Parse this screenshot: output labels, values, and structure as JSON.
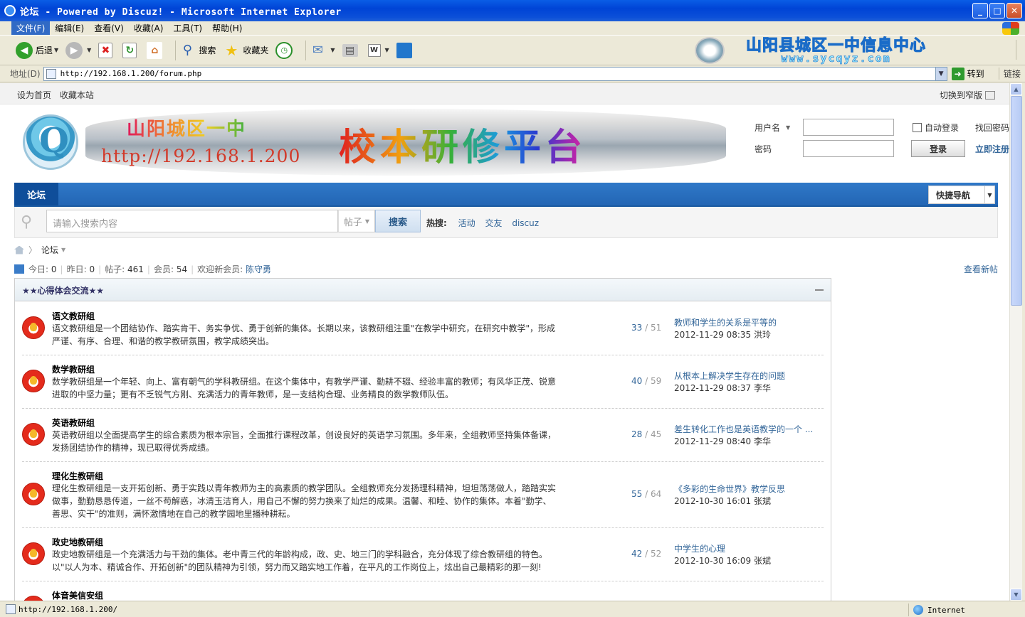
{
  "window": {
    "title": "论坛 - Powered by Discuz! - Microsoft Internet Explorer",
    "minimize": "_",
    "maximize": "□",
    "close": "✕"
  },
  "menubar": [
    "文件(F)",
    "编辑(E)",
    "查看(V)",
    "收藏(A)",
    "工具(T)",
    "帮助(H)"
  ],
  "toolbar": {
    "back": "后退",
    "search": "搜索",
    "favorites": "收藏夹",
    "banner_cn": "山阳县城区一中信息中心",
    "banner_en": "www.sycqyz.com"
  },
  "address": {
    "label": "地址(D)",
    "url": "http://192.168.1.200/forum.php",
    "go": "转到",
    "links": "链接"
  },
  "topnav": {
    "set_home": "设为首页",
    "bookmark": "收藏本站",
    "switch_width": "切换到窄版"
  },
  "header": {
    "school": "山阳城区一中",
    "ip": "http://192.168.1.200",
    "platform": "校本研修平台"
  },
  "login": {
    "username_label": "用户名",
    "password_label": "密码",
    "auto_login": "自动登录",
    "find_password": "找回密码",
    "login_btn": "登录",
    "register": "立即注册"
  },
  "nav": {
    "forum_tab": "论坛",
    "quick_nav": "快捷导航"
  },
  "search": {
    "placeholder": "请输入搜索内容",
    "type": "帖子",
    "button": "搜索",
    "hot_label": "热搜:",
    "hot": [
      "活动",
      "交友",
      "discuz"
    ]
  },
  "breadcrumb": {
    "current": "论坛"
  },
  "stats": {
    "today_label": "今日:",
    "today": "0",
    "yesterday_label": "昨日:",
    "yesterday": "0",
    "posts_label": "帖子:",
    "posts": "461",
    "members_label": "会员:",
    "members": "54",
    "newest_label": "欢迎新会员:",
    "newest": "陈守勇",
    "view_new": "查看新帖"
  },
  "category": {
    "title": "★★心得体会交流★★",
    "forums": [
      {
        "name": "语文教研组",
        "desc": "语文教研组是一个团结协作、踏实肯干、务实争优、勇于创新的集体。长期以来，该教研组注重\"在教学中研究，在研究中教学\"，形成严谨、有序、合理、和谐的教学教研氛围，教学成绩突出。",
        "threads": "33",
        "posts": "51",
        "last_title": "教师和学生的关系是平等的",
        "last_meta": "2012-11-29 08:35 洪玲"
      },
      {
        "name": "数学教研组",
        "desc": "数学教研组是一个年轻、向上、富有朝气的学科教研组。在这个集体中，有教学严谨、勤耕不辍、经验丰富的教师；有风华正茂、锐意进取的中坚力量；更有不乏锐气方刚、充满活力的青年教师，是一支结构合理、业务精良的数学教师队伍。",
        "threads": "40",
        "posts": "59",
        "last_title": "从根本上解决学生存在的问题",
        "last_meta": "2012-11-29 08:37 李华"
      },
      {
        "name": "英语教研组",
        "desc": "英语教研组以全面提高学生的综合素质为根本宗旨，全面推行课程改革，创设良好的英语学习氛围。多年来，全组教师坚持集体备课，发扬团结协作的精神，现已取得优秀成绩。",
        "threads": "28",
        "posts": "45",
        "last_title": "差生转化工作也是英语教学的一个 ...",
        "last_meta": "2012-11-29 08:40 李华"
      },
      {
        "name": "理化生教研组",
        "desc": "理化生教研组是一支开拓创新、勇于实践以青年教师为主的高素质的教学团队。全组教师充分发扬理科精神，坦坦荡荡做人，踏踏实实做事，勤勤恳恳传道，一丝不苟解惑，冰清玉洁育人，用自己不懈的努力换来了灿烂的成果。温馨、和睦、协作的集体。本着\"勤学、善思、实干\"的准则，满怀激情地在自己的教学园地里播种耕耘。",
        "threads": "55",
        "posts": "64",
        "last_title": "《多彩的生命世界》教学反思",
        "last_meta": "2012-10-30 16:01 张斌"
      },
      {
        "name": "政史地教研组",
        "desc": "政史地教研组是一个充满活力与干劲的集体。老中青三代的年龄构成，政、史、地三门的学科融合，充分体现了综合教研组的特色。以\"以人为本、精诚合作、开拓创新\"的团队精神为引领，努力而又踏实地工作着，在平凡的工作岗位上，炫出自己最精彩的那一刻!",
        "threads": "42",
        "posts": "52",
        "last_title": "中学生的心理",
        "last_meta": "2012-10-30 16:09 张斌"
      },
      {
        "name": "体音美信安组",
        "desc": "",
        "threads": "",
        "posts": "",
        "last_title": "",
        "last_meta": ""
      }
    ]
  },
  "statusbar": {
    "url": "http://192.168.1.200/",
    "zone": "Internet"
  }
}
